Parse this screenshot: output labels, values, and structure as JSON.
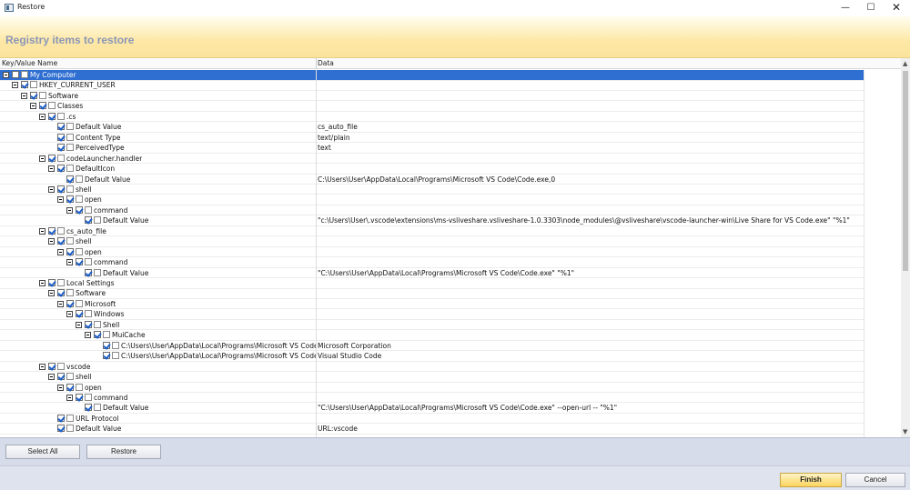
{
  "window": {
    "title": "Restore",
    "min_label": "—",
    "max_label": "☐",
    "close_label": "✕"
  },
  "header": {
    "title": "Registry items to restore"
  },
  "columns": {
    "key": "Key/Value Name",
    "data": "Data"
  },
  "rows": [
    {
      "label": "My Computer",
      "data": "",
      "level": 0,
      "expander": true,
      "checked": false,
      "selected": true
    },
    {
      "label": "HKEY_CURRENT_USER",
      "data": "",
      "level": 1,
      "expander": true,
      "checked": true
    },
    {
      "label": "Software",
      "data": "",
      "level": 2,
      "expander": true,
      "checked": true
    },
    {
      "label": "Classes",
      "data": "",
      "level": 3,
      "expander": true,
      "checked": true
    },
    {
      "label": ".cs",
      "data": "",
      "level": 4,
      "expander": true,
      "checked": true
    },
    {
      "label": "Default Value",
      "data": "cs_auto_file",
      "level": 5,
      "expander": false,
      "checked": true
    },
    {
      "label": "Content Type",
      "data": "text/plain",
      "level": 5,
      "expander": false,
      "checked": true
    },
    {
      "label": "PerceivedType",
      "data": "text",
      "level": 5,
      "expander": false,
      "checked": true
    },
    {
      "label": "codeLauncher.handler",
      "data": "",
      "level": 4,
      "expander": true,
      "checked": true
    },
    {
      "label": "DefaultIcon",
      "data": "",
      "level": 5,
      "expander": true,
      "checked": true
    },
    {
      "label": "Default Value",
      "data": "C:\\Users\\User\\AppData\\Local\\Programs\\Microsoft VS Code\\Code.exe,0",
      "level": 6,
      "expander": false,
      "checked": true
    },
    {
      "label": "shell",
      "data": "",
      "level": 5,
      "expander": true,
      "checked": true
    },
    {
      "label": "open",
      "data": "",
      "level": 6,
      "expander": true,
      "checked": true
    },
    {
      "label": "command",
      "data": "",
      "level": 7,
      "expander": true,
      "checked": true
    },
    {
      "label": "Default Value",
      "data": "\"c:\\Users\\User\\.vscode\\extensions\\ms-vsliveshare.vsliveshare-1.0.3303\\node_modules\\@vsliveshare\\vscode-launcher-win\\Live Share for VS Code.exe\" \"%1\"",
      "level": 8,
      "expander": false,
      "checked": true
    },
    {
      "label": "cs_auto_file",
      "data": "",
      "level": 4,
      "expander": true,
      "checked": true
    },
    {
      "label": "shell",
      "data": "",
      "level": 5,
      "expander": true,
      "checked": true
    },
    {
      "label": "open",
      "data": "",
      "level": 6,
      "expander": true,
      "checked": true
    },
    {
      "label": "command",
      "data": "",
      "level": 7,
      "expander": true,
      "checked": true
    },
    {
      "label": "Default Value",
      "data": "\"C:\\Users\\User\\AppData\\Local\\Programs\\Microsoft VS Code\\Code.exe\" \"%1\"",
      "level": 8,
      "expander": false,
      "checked": true
    },
    {
      "label": "Local Settings",
      "data": "",
      "level": 4,
      "expander": true,
      "checked": true
    },
    {
      "label": "Software",
      "data": "",
      "level": 5,
      "expander": true,
      "checked": true
    },
    {
      "label": "Microsoft",
      "data": "",
      "level": 6,
      "expander": true,
      "checked": true
    },
    {
      "label": "Windows",
      "data": "",
      "level": 7,
      "expander": true,
      "checked": true
    },
    {
      "label": "Shell",
      "data": "",
      "level": 8,
      "expander": true,
      "checked": true
    },
    {
      "label": "MuiCache",
      "data": "",
      "level": 9,
      "expander": true,
      "checked": true
    },
    {
      "label": "C:\\Users\\User\\AppData\\Local\\Programs\\Microsoft VS Code\\Code.exe.FriendlyAppName",
      "data": "Microsoft Corporation",
      "level": 10,
      "expander": false,
      "checked": true
    },
    {
      "label": "C:\\Users\\User\\AppData\\Local\\Programs\\Microsoft VS Code\\Code.exe.ApplicationCompany",
      "data": "Visual Studio Code",
      "level": 10,
      "expander": false,
      "checked": true
    },
    {
      "label": "vscode",
      "data": "",
      "level": 4,
      "expander": true,
      "checked": true
    },
    {
      "label": "shell",
      "data": "",
      "level": 5,
      "expander": true,
      "checked": true
    },
    {
      "label": "open",
      "data": "",
      "level": 6,
      "expander": true,
      "checked": true
    },
    {
      "label": "command",
      "data": "",
      "level": 7,
      "expander": true,
      "checked": true
    },
    {
      "label": "Default Value",
      "data": "\"C:\\Users\\User\\AppData\\Local\\Programs\\Microsoft VS Code\\Code.exe\" --open-url -- \"%1\"",
      "level": 8,
      "expander": false,
      "checked": true
    },
    {
      "label": "URL Protocol",
      "data": "",
      "level": 5,
      "expander": false,
      "checked": true
    },
    {
      "label": "Default Value",
      "data": "URL:vscode",
      "level": 5,
      "expander": false,
      "checked": true
    }
  ],
  "buttons": {
    "select_all": "Select All",
    "restore": "Restore",
    "finish": "Finish",
    "cancel": "Cancel"
  },
  "scroll": {
    "up": "▲",
    "down": "▼"
  }
}
